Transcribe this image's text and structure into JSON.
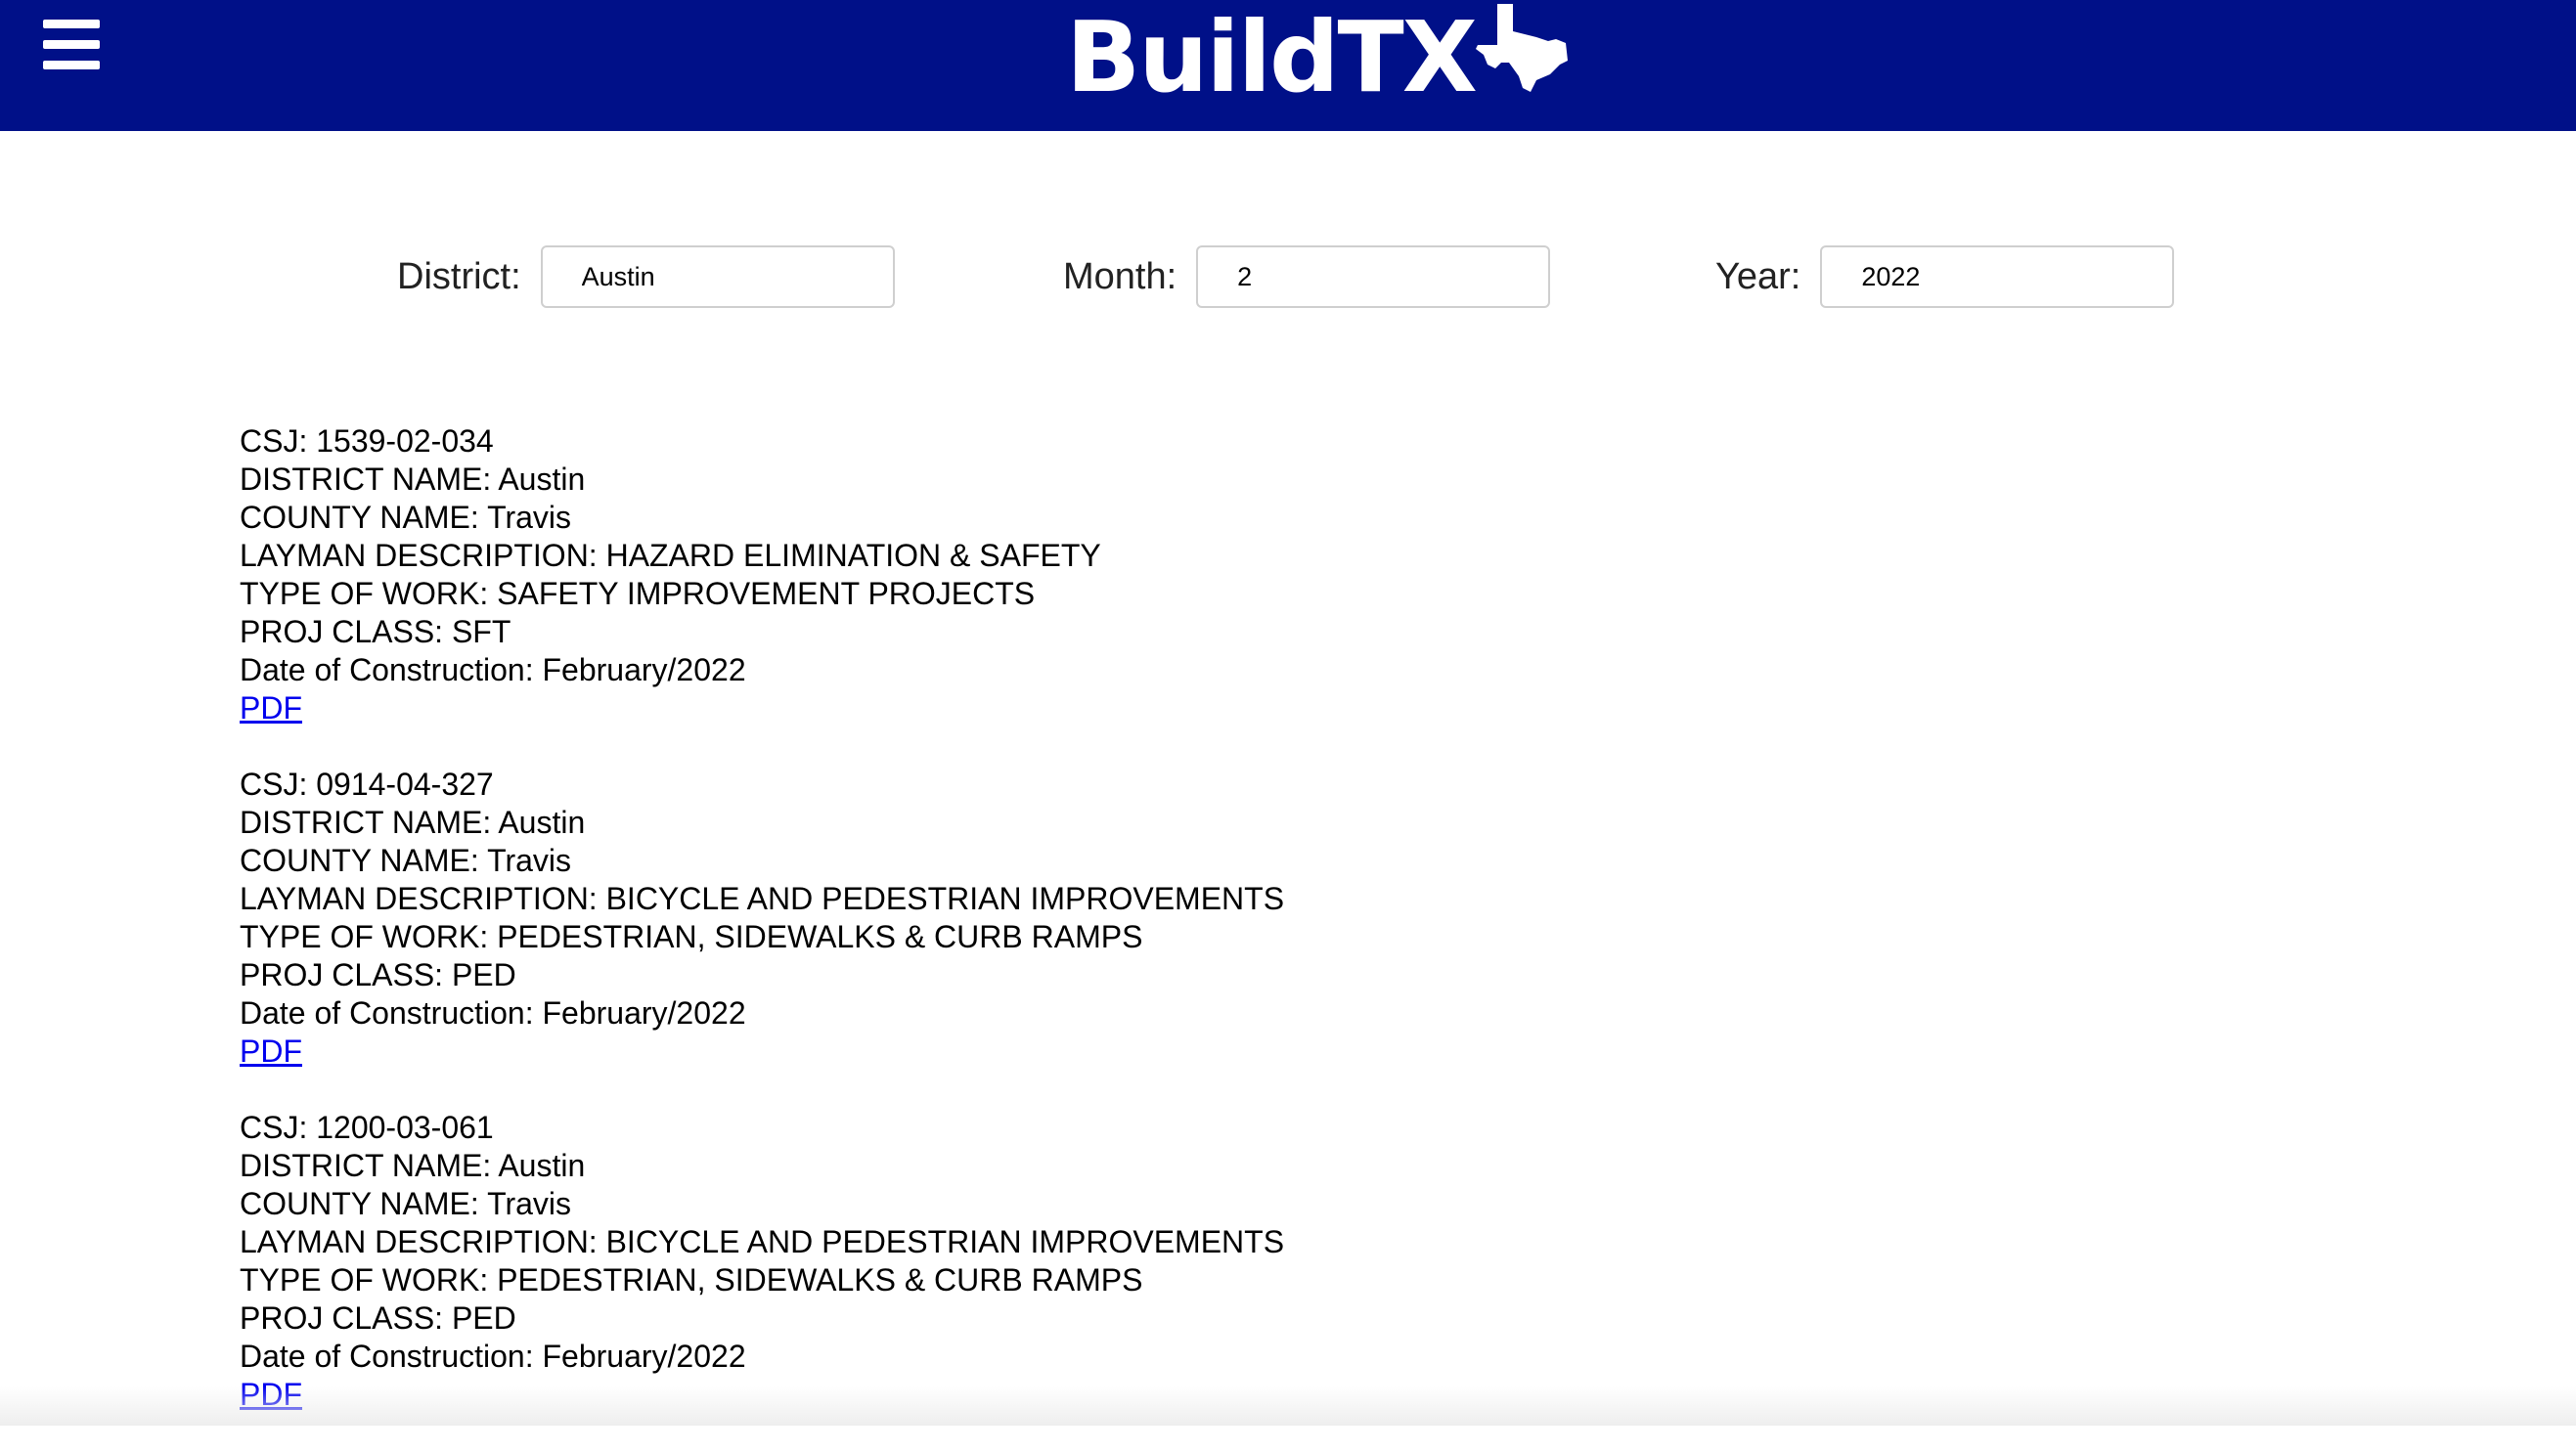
{
  "header": {
    "brand": "BuildTX",
    "menu_icon": "hamburger-menu-icon",
    "logo_icon": "texas-state-icon",
    "background": "#001088"
  },
  "filters": {
    "district": {
      "label": "District:",
      "value": "Austin"
    },
    "month": {
      "label": "Month:",
      "value": "2"
    },
    "year": {
      "label": "Year:",
      "value": "2022"
    }
  },
  "records": [
    {
      "csj": "CSJ: 1539-02-034",
      "district": "DISTRICT NAME: Austin",
      "county": "COUNTY NAME: Travis",
      "description": "LAYMAN DESCRIPTION: HAZARD ELIMINATION & SAFETY",
      "type_of_work": "TYPE OF WORK: SAFETY IMPROVEMENT PROJECTS",
      "proj_class": "PROJ CLASS: SFT",
      "date": "Date of Construction: February/2022",
      "link": "PDF"
    },
    {
      "csj": "CSJ: 0914-04-327",
      "district": "DISTRICT NAME: Austin",
      "county": "COUNTY NAME: Travis",
      "description": "LAYMAN DESCRIPTION: BICYCLE AND PEDESTRIAN IMPROVEMENTS",
      "type_of_work": "TYPE OF WORK: PEDESTRIAN, SIDEWALKS & CURB RAMPS",
      "proj_class": "PROJ CLASS: PED",
      "date": "Date of Construction: February/2022",
      "link": "PDF"
    },
    {
      "csj": "CSJ: 1200-03-061",
      "district": "DISTRICT NAME: Austin",
      "county": "COUNTY NAME: Travis",
      "description": "LAYMAN DESCRIPTION: BICYCLE AND PEDESTRIAN IMPROVEMENTS",
      "type_of_work": "TYPE OF WORK: PEDESTRIAN, SIDEWALKS & CURB RAMPS",
      "proj_class": "PROJ CLASS: PED",
      "date": "Date of Construction: February/2022",
      "link": "PDF"
    }
  ]
}
